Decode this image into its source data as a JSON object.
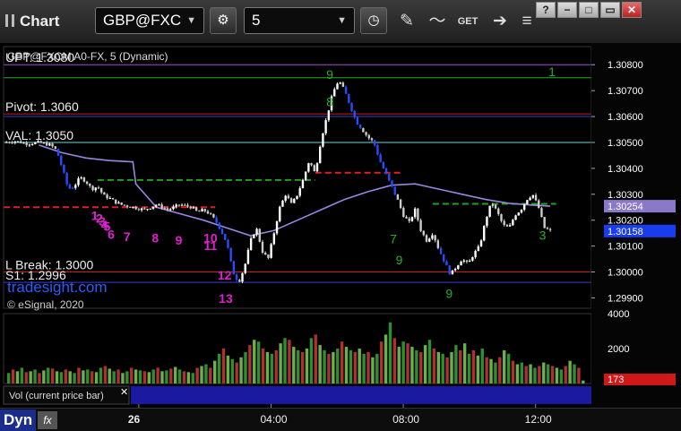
{
  "toolbar": {
    "title": "Chart",
    "symbol": "GBP@FXC",
    "interval": "5",
    "window_buttons": [
      "?",
      "−",
      "□",
      "✕"
    ]
  },
  "chart_data": {
    "type": "candlestick",
    "instrument_label": "GBP@FXCM A0-FX, 5 (Dynamic)",
    "copyright": "© eSignal, 2020",
    "watermark": "tradesight.com",
    "price_axis": {
      "ylim": [
        1.2986,
        1.3087
      ],
      "ticks": [
        "1.30800",
        "1.30700",
        "1.30600",
        "1.30500",
        "1.30400",
        "1.30300",
        "1.30200",
        "1.30100",
        "1.30000",
        "1.29900"
      ],
      "last_price_label": "1.30158",
      "ma_value_label": "1.30254"
    },
    "time_axis": {
      "labels": [
        "26",
        "04:00",
        "08:00",
        "12:00"
      ]
    },
    "levels": [
      {
        "label": "UPT: 1.3080",
        "price": 1.308,
        "color": "#a44bd6"
      },
      {
        "label": "",
        "price": 1.3075,
        "color": "#22b022"
      },
      {
        "label": "Pivot: 1.3060",
        "price": 1.3061,
        "color": "#c81e1e"
      },
      {
        "label": "",
        "price": 1.306,
        "color": "#3a3acf"
      },
      {
        "label": "VAL: 1.3050",
        "price": 1.305,
        "color": "#6fd6d6"
      },
      {
        "label": "L Break: 1.3000",
        "price": 1.3,
        "color": "#c81e1e"
      },
      {
        "label": "S1: 1.2996",
        "price": 1.2996,
        "color": "#3a3acf"
      }
    ],
    "dashed_levels": [
      {
        "price": 1.3025,
        "color": "#e02020",
        "x_from": 0.0,
        "x_to": 0.36
      },
      {
        "price": 1.30355,
        "color": "#22a022",
        "x_from": 0.16,
        "x_to": 0.53
      },
      {
        "price": 1.30383,
        "color": "#e02020",
        "x_from": 0.53,
        "x_to": 0.68
      },
      {
        "price": 1.30263,
        "color": "#22a022",
        "x_from": 0.73,
        "x_to": 0.94
      }
    ],
    "price_path": [
      [
        0.0,
        1.305
      ],
      [
        0.02,
        1.30505
      ],
      [
        0.04,
        1.30495
      ],
      [
        0.06,
        1.305
      ],
      [
        0.08,
        1.3049
      ],
      [
        0.09,
        1.3047
      ],
      [
        0.1,
        1.304
      ],
      [
        0.11,
        1.3032
      ],
      [
        0.12,
        1.3033
      ],
      [
        0.13,
        1.30365
      ],
      [
        0.14,
        1.3035
      ],
      [
        0.15,
        1.3032
      ],
      [
        0.16,
        1.3033
      ],
      [
        0.17,
        1.30295
      ],
      [
        0.18,
        1.30285
      ],
      [
        0.19,
        1.3027
      ],
      [
        0.2,
        1.3026
      ],
      [
        0.22,
        1.3025
      ],
      [
        0.24,
        1.3024
      ],
      [
        0.26,
        1.3026
      ],
      [
        0.28,
        1.3024
      ],
      [
        0.3,
        1.3026
      ],
      [
        0.32,
        1.3025
      ],
      [
        0.33,
        1.3023
      ],
      [
        0.34,
        1.3024
      ],
      [
        0.35,
        1.30225
      ],
      [
        0.36,
        1.302
      ],
      [
        0.37,
        1.3016
      ],
      [
        0.38,
        1.3011
      ],
      [
        0.39,
        1.3
      ],
      [
        0.4,
        1.2996
      ],
      [
        0.41,
        1.3002
      ],
      [
        0.42,
        1.3012
      ],
      [
        0.43,
        1.3017
      ],
      [
        0.44,
        1.3008
      ],
      [
        0.45,
        1.3005
      ],
      [
        0.46,
        1.3015
      ],
      [
        0.47,
        1.3025
      ],
      [
        0.48,
        1.303
      ],
      [
        0.49,
        1.3026
      ],
      [
        0.5,
        1.303
      ],
      [
        0.51,
        1.3036
      ],
      [
        0.52,
        1.3043
      ],
      [
        0.53,
        1.3038
      ],
      [
        0.54,
        1.3051
      ],
      [
        0.55,
        1.306
      ],
      [
        0.56,
        1.3069
      ],
      [
        0.57,
        1.3074
      ],
      [
        0.58,
        1.307
      ],
      [
        0.59,
        1.3064
      ],
      [
        0.6,
        1.3058
      ],
      [
        0.61,
        1.3055
      ],
      [
        0.62,
        1.3052
      ],
      [
        0.63,
        1.305
      ],
      [
        0.64,
        1.3043
      ],
      [
        0.65,
        1.3038
      ],
      [
        0.66,
        1.3033
      ],
      [
        0.67,
        1.3028
      ],
      [
        0.68,
        1.3022
      ],
      [
        0.69,
        1.3019
      ],
      [
        0.7,
        1.3024
      ],
      [
        0.71,
        1.3016
      ],
      [
        0.72,
        1.3012
      ],
      [
        0.73,
        1.3015
      ],
      [
        0.74,
        1.3009
      ],
      [
        0.75,
        1.3004
      ],
      [
        0.76,
        1.2999
      ],
      [
        0.77,
        1.3002
      ],
      [
        0.78,
        1.3005
      ],
      [
        0.79,
        1.3003
      ],
      [
        0.8,
        1.3007
      ],
      [
        0.81,
        1.301
      ],
      [
        0.82,
        1.302
      ],
      [
        0.83,
        1.3027
      ],
      [
        0.84,
        1.3023
      ],
      [
        0.85,
        1.3018
      ],
      [
        0.86,
        1.3017
      ],
      [
        0.87,
        1.3022
      ],
      [
        0.88,
        1.3024
      ],
      [
        0.89,
        1.3028
      ],
      [
        0.9,
        1.303
      ],
      [
        0.91,
        1.3025
      ],
      [
        0.92,
        1.3017
      ],
      [
        0.93,
        1.30158
      ]
    ],
    "moving_average": [
      [
        0.06,
        1.3049
      ],
      [
        0.1,
        1.3046
      ],
      [
        0.14,
        1.3044
      ],
      [
        0.18,
        1.3043
      ],
      [
        0.22,
        1.30425
      ],
      [
        0.225,
        1.3034
      ],
      [
        0.26,
        1.3025
      ],
      [
        0.3,
        1.30225
      ],
      [
        0.34,
        1.302
      ],
      [
        0.38,
        1.3017
      ],
      [
        0.42,
        1.3014
      ],
      [
        0.46,
        1.3016
      ],
      [
        0.5,
        1.302
      ],
      [
        0.54,
        1.3024
      ],
      [
        0.58,
        1.3028
      ],
      [
        0.62,
        1.3031
      ],
      [
        0.66,
        1.30335
      ],
      [
        0.7,
        1.3034
      ],
      [
        0.74,
        1.3032
      ],
      [
        0.78,
        1.303
      ],
      [
        0.82,
        1.3028
      ],
      [
        0.86,
        1.30265
      ],
      [
        0.9,
        1.30258
      ],
      [
        0.93,
        1.30254
      ]
    ],
    "td_counts": [
      {
        "text": "1",
        "x": 0.155,
        "price": 1.302,
        "color": "#e020d0"
      },
      {
        "text": "2",
        "x": 0.163,
        "price": 1.3019,
        "color": "#e020d0"
      },
      {
        "text": "3",
        "x": 0.168,
        "price": 1.30178,
        "color": "#e020d0"
      },
      {
        "text": "4",
        "x": 0.172,
        "price": 1.30165,
        "color": "#e020d0"
      },
      {
        "text": "5",
        "x": 0.176,
        "price": 1.3016,
        "color": "#e020d0"
      },
      {
        "text": "6",
        "x": 0.183,
        "price": 1.30128,
        "color": "#e020d0"
      },
      {
        "text": "7",
        "x": 0.21,
        "price": 1.3012,
        "color": "#e020d0"
      },
      {
        "text": "8",
        "x": 0.258,
        "price": 1.30115,
        "color": "#e020d0"
      },
      {
        "text": "9",
        "x": 0.298,
        "price": 1.30105,
        "color": "#e020d0"
      },
      {
        "text": "10",
        "x": 0.352,
        "price": 1.30115,
        "color": "#e020d0"
      },
      {
        "text": "11",
        "x": 0.352,
        "price": 1.30085,
        "color": "#e020d0"
      },
      {
        "text": "12",
        "x": 0.376,
        "price": 1.2997,
        "color": "#e020d0"
      },
      {
        "text": "13",
        "x": 0.378,
        "price": 1.2988,
        "color": "#e020d0"
      },
      {
        "text": "8",
        "x": 0.555,
        "price": 1.3064,
        "color": "#22b022"
      },
      {
        "text": "9",
        "x": 0.555,
        "price": 1.30745,
        "color": "#22b022"
      },
      {
        "text": "1",
        "x": 0.933,
        "price": 1.30755,
        "color": "#22b022"
      },
      {
        "text": "9",
        "x": 0.673,
        "price": 1.3003,
        "color": "#22b022"
      },
      {
        "text": "7",
        "x": 0.663,
        "price": 1.3011,
        "color": "#22b022"
      },
      {
        "text": "9",
        "x": 0.758,
        "price": 1.299,
        "color": "#22b022"
      },
      {
        "text": "3",
        "x": 0.917,
        "price": 1.30125,
        "color": "#22b022"
      }
    ],
    "volume": {
      "label": "Vol (current price bar)",
      "ylim": [
        0,
        4000
      ],
      "ticks": [
        "4000",
        "2000"
      ],
      "last_value_label": "173",
      "values": [
        600,
        800,
        700,
        900,
        650,
        700,
        800,
        600,
        750,
        900,
        850,
        700,
        650,
        800,
        700,
        600,
        900,
        750,
        800,
        700,
        650,
        900,
        1000,
        850,
        700,
        800,
        600,
        700,
        900,
        800,
        750,
        700,
        650,
        800,
        900,
        700,
        750,
        850,
        950,
        800,
        700,
        650,
        600,
        900,
        1000,
        1100,
        900,
        1300,
        1700,
        2000,
        1600,
        1400,
        1200,
        1500,
        1800,
        2200,
        2500,
        2400,
        2000,
        1800,
        1700,
        1900,
        2300,
        2600,
        2500,
        2100,
        1900,
        1800,
        2000,
        2600,
        2800,
        2200,
        1900,
        1700,
        1800,
        2000,
        2400,
        2100,
        1900,
        1800,
        2000,
        1700,
        1800,
        1500,
        1700,
        2400,
        2800,
        3500,
        2600,
        2100,
        2400,
        2300,
        2100,
        1900,
        1800,
        2200,
        2500,
        2000,
        1800,
        1700,
        1500,
        1800,
        2200,
        1900,
        2300,
        1700,
        1900,
        1600,
        2000,
        1500,
        1400,
        1200,
        1500,
        1900,
        1700,
        1300,
        1100,
        1200,
        1000,
        1100,
        900,
        1000,
        1200,
        1100,
        1000,
        900,
        800,
        1000,
        1300,
        1100,
        900,
        173
      ]
    }
  },
  "bottom": {
    "left_label": "Dyn",
    "fx_label": "fx"
  }
}
